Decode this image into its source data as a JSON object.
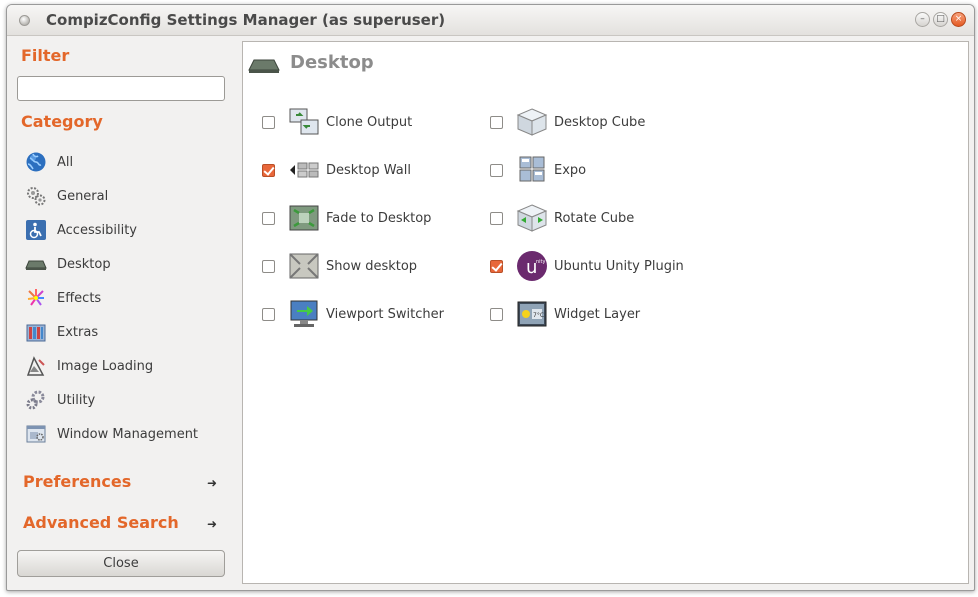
{
  "window": {
    "title": "CompizConfig Settings Manager (as superuser)"
  },
  "sidebar": {
    "filter_heading": "Filter",
    "filter_value": "",
    "category_heading": "Category",
    "categories": [
      {
        "label": "All",
        "icon": "globe-icon"
      },
      {
        "label": "General",
        "icon": "gears-icon"
      },
      {
        "label": "Accessibility",
        "icon": "accessibility-icon"
      },
      {
        "label": "Desktop",
        "icon": "desktop-icon"
      },
      {
        "label": "Effects",
        "icon": "fireworks-icon"
      },
      {
        "label": "Extras",
        "icon": "extras-icon"
      },
      {
        "label": "Image Loading",
        "icon": "image-loading-icon"
      },
      {
        "label": "Utility",
        "icon": "utility-icon"
      },
      {
        "label": "Window Management",
        "icon": "window-management-icon"
      }
    ],
    "preferences_label": "Preferences",
    "advanced_search_label": "Advanced Search",
    "close_label": "Close"
  },
  "main": {
    "title": "Desktop",
    "plugins": [
      {
        "label": "Clone Output",
        "checked": false,
        "icon": "clone-output-icon"
      },
      {
        "label": "Desktop Cube",
        "checked": false,
        "icon": "desktop-cube-icon"
      },
      {
        "label": "Desktop Wall",
        "checked": true,
        "icon": "desktop-wall-icon"
      },
      {
        "label": "Expo",
        "checked": false,
        "icon": "expo-icon"
      },
      {
        "label": "Fade to Desktop",
        "checked": false,
        "icon": "fade-to-desktop-icon"
      },
      {
        "label": "Rotate Cube",
        "checked": false,
        "icon": "rotate-cube-icon"
      },
      {
        "label": "Show desktop",
        "checked": false,
        "icon": "show-desktop-icon"
      },
      {
        "label": "Ubuntu Unity Plugin",
        "checked": true,
        "icon": "ubuntu-unity-icon"
      },
      {
        "label": "Viewport Switcher",
        "checked": false,
        "icon": "viewport-switcher-icon"
      },
      {
        "label": "Widget Layer",
        "checked": false,
        "icon": "widget-layer-icon"
      }
    ]
  },
  "colors": {
    "accent": "#e3672a",
    "check": "#e8673a"
  }
}
